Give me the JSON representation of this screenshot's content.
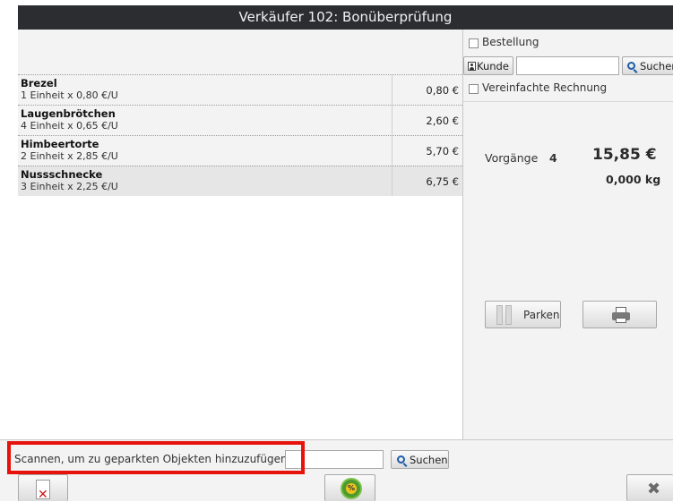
{
  "title": "Verkäufer 102: Bonüberprüfung",
  "items": [
    {
      "name": "Brezel",
      "detail": "1 Einheit x 0,80 €/U",
      "price": "0,80 €"
    },
    {
      "name": "Laugenbrötchen",
      "detail": "4 Einheit x 0,65 €/U",
      "price": "2,60 €"
    },
    {
      "name": "Himbeertorte",
      "detail": "2 Einheit x 2,85 €/U",
      "price": "5,70 €"
    },
    {
      "name": "Nussschnecke",
      "detail": "3 Einheit x 2,25 €/U",
      "price": "6,75 €",
      "selected": true
    }
  ],
  "right": {
    "order_label": "Bestellung",
    "customer_button": "Kunde",
    "customer_value": "",
    "search_label": "Suchen",
    "simplified_invoice": "Vereinfachte Rechnung",
    "transactions_label": "Vorgänge",
    "transactions_count": "4",
    "total": "15,85 €",
    "weight": "0,000 kg",
    "park_label": "Parken"
  },
  "bottom": {
    "scan_label": "Scannen, um zu geparkten Objekten hinzuzufügen",
    "scan_value": "",
    "search_label": "Suchen"
  },
  "icons": [
    "delete-ticket-icon",
    "discount-icon",
    "close-icon",
    "print-icon",
    "park-icon",
    "customer-icon",
    "search-icon"
  ],
  "colors": {
    "titlebar": "#2b2d31",
    "highlight": "#e8120c"
  }
}
